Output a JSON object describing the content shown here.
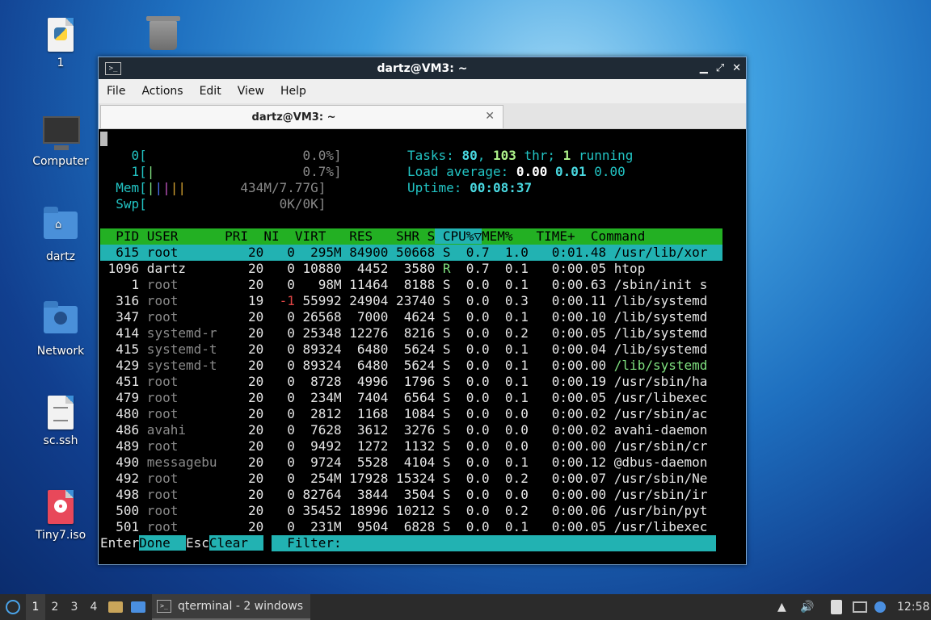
{
  "desktop": {
    "icons": [
      {
        "label": "1",
        "icon": "python-file-icon"
      },
      {
        "label": "",
        "icon": "trash-icon"
      },
      {
        "label": "Computer",
        "icon": "computer-icon"
      },
      {
        "label": "dartz",
        "icon": "home-folder-icon"
      },
      {
        "label": "Network",
        "icon": "network-folder-icon"
      },
      {
        "label": "sc.ssh",
        "icon": "text-file-icon"
      },
      {
        "label": "Tiny7.iso",
        "icon": "disc-image-icon"
      }
    ]
  },
  "window": {
    "title": "dartz@VM3: ~",
    "menu": [
      "File",
      "Actions",
      "Edit",
      "View",
      "Help"
    ],
    "tab_label": "dartz@VM3: ~",
    "close_glyph": "✕"
  },
  "htop": {
    "cpu0": {
      "label": "0[",
      "value": "0.0%]"
    },
    "cpu1": {
      "label": "1[",
      "bars": "|",
      "value": "0.7%]"
    },
    "mem": {
      "label": "Mem[",
      "value": "434M/7.77G]"
    },
    "swp": {
      "label": "Swp[",
      "value": "0K/0K]"
    },
    "tasks": {
      "label": "Tasks: ",
      "count": "80",
      "sep": ", ",
      "threads": "103",
      "thr": " thr; ",
      "running": "1",
      "running_label": " running"
    },
    "load": {
      "label": "Load average: ",
      "l1": "0.00",
      "l5": "0.01",
      "l15": "0.00"
    },
    "uptime": {
      "label": "Uptime: ",
      "value": "00:08:37"
    },
    "columns": {
      "pid": "  PID",
      "user": " USER",
      "pri": "      PRI",
      "ni": "  NI",
      "virt": "  VIRT",
      "res": "   RES",
      "shr": "   SHR",
      "s": " S",
      "cpu": " CPU%▽",
      "mem": "MEM%",
      "time": "   TIME+ ",
      "cmd": " Command"
    },
    "processes": [
      {
        "pid": "615",
        "user": "root",
        "pri": "20",
        "ni": "0",
        "virt": "295M",
        "res": "84900",
        "shr": "50668",
        "s": "S",
        "cpu": "0.7",
        "mem": "1.0",
        "time": "0:01.48",
        "cmd": "/usr/lib/xor"
      },
      {
        "pid": "1096",
        "user": "dartz",
        "pri": "20",
        "ni": "0",
        "virt": "10880",
        "res": "4452",
        "shr": "3580",
        "s": "R",
        "cpu": "0.7",
        "mem": "0.1",
        "time": "0:00.05",
        "cmd": "htop"
      },
      {
        "pid": "1",
        "user": "root",
        "pri": "20",
        "ni": "0",
        "virt": "98M",
        "res": "11464",
        "shr": "8188",
        "s": "S",
        "cpu": "0.0",
        "mem": "0.1",
        "time": "0:00.63",
        "cmd": "/sbin/init s"
      },
      {
        "pid": "316",
        "user": "root",
        "pri": "19",
        "ni": "-1",
        "virt": "55992",
        "res": "24904",
        "shr": "23740",
        "s": "S",
        "cpu": "0.0",
        "mem": "0.3",
        "time": "0:00.11",
        "cmd": "/lib/systemd"
      },
      {
        "pid": "347",
        "user": "root",
        "pri": "20",
        "ni": "0",
        "virt": "26568",
        "res": "7000",
        "shr": "4624",
        "s": "S",
        "cpu": "0.0",
        "mem": "0.1",
        "time": "0:00.10",
        "cmd": "/lib/systemd"
      },
      {
        "pid": "414",
        "user": "systemd-r",
        "pri": "20",
        "ni": "0",
        "virt": "25348",
        "res": "12276",
        "shr": "8216",
        "s": "S",
        "cpu": "0.0",
        "mem": "0.2",
        "time": "0:00.05",
        "cmd": "/lib/systemd"
      },
      {
        "pid": "415",
        "user": "systemd-t",
        "pri": "20",
        "ni": "0",
        "virt": "89324",
        "res": "6480",
        "shr": "5624",
        "s": "S",
        "cpu": "0.0",
        "mem": "0.1",
        "time": "0:00.04",
        "cmd": "/lib/systemd"
      },
      {
        "pid": "429",
        "user": "systemd-t",
        "pri": "20",
        "ni": "0",
        "virt": "89324",
        "res": "6480",
        "shr": "5624",
        "s": "S",
        "cpu": "0.0",
        "mem": "0.1",
        "time": "0:00.00",
        "cmd": "/lib/systemd"
      },
      {
        "pid": "451",
        "user": "root",
        "pri": "20",
        "ni": "0",
        "virt": "8728",
        "res": "4996",
        "shr": "1796",
        "s": "S",
        "cpu": "0.0",
        "mem": "0.1",
        "time": "0:00.19",
        "cmd": "/usr/sbin/ha"
      },
      {
        "pid": "479",
        "user": "root",
        "pri": "20",
        "ni": "0",
        "virt": "234M",
        "res": "7404",
        "shr": "6564",
        "s": "S",
        "cpu": "0.0",
        "mem": "0.1",
        "time": "0:00.05",
        "cmd": "/usr/libexec"
      },
      {
        "pid": "480",
        "user": "root",
        "pri": "20",
        "ni": "0",
        "virt": "2812",
        "res": "1168",
        "shr": "1084",
        "s": "S",
        "cpu": "0.0",
        "mem": "0.0",
        "time": "0:00.02",
        "cmd": "/usr/sbin/ac"
      },
      {
        "pid": "486",
        "user": "avahi",
        "pri": "20",
        "ni": "0",
        "virt": "7628",
        "res": "3612",
        "shr": "3276",
        "s": "S",
        "cpu": "0.0",
        "mem": "0.0",
        "time": "0:00.02",
        "cmd": "avahi-daemon"
      },
      {
        "pid": "489",
        "user": "root",
        "pri": "20",
        "ni": "0",
        "virt": "9492",
        "res": "1272",
        "shr": "1132",
        "s": "S",
        "cpu": "0.0",
        "mem": "0.0",
        "time": "0:00.00",
        "cmd": "/usr/sbin/cr"
      },
      {
        "pid": "490",
        "user": "messagebu",
        "pri": "20",
        "ni": "0",
        "virt": "9724",
        "res": "5528",
        "shr": "4104",
        "s": "S",
        "cpu": "0.0",
        "mem": "0.1",
        "time": "0:00.12",
        "cmd": "@dbus-daemon"
      },
      {
        "pid": "492",
        "user": "root",
        "pri": "20",
        "ni": "0",
        "virt": "254M",
        "res": "17928",
        "shr": "15324",
        "s": "S",
        "cpu": "0.0",
        "mem": "0.2",
        "time": "0:00.07",
        "cmd": "/usr/sbin/Ne"
      },
      {
        "pid": "498",
        "user": "root",
        "pri": "20",
        "ni": "0",
        "virt": "82764",
        "res": "3844",
        "shr": "3504",
        "s": "S",
        "cpu": "0.0",
        "mem": "0.0",
        "time": "0:00.00",
        "cmd": "/usr/sbin/ir"
      },
      {
        "pid": "500",
        "user": "root",
        "pri": "20",
        "ni": "0",
        "virt": "35452",
        "res": "18996",
        "shr": "10212",
        "s": "S",
        "cpu": "0.0",
        "mem": "0.2",
        "time": "0:00.06",
        "cmd": "/usr/bin/pyt"
      },
      {
        "pid": "501",
        "user": "root",
        "pri": "20",
        "ni": "0",
        "virt": "231M",
        "res": "9504",
        "shr": "6828",
        "s": "S",
        "cpu": "0.0",
        "mem": "0.1",
        "time": "0:00.05",
        "cmd": "/usr/libexec"
      }
    ],
    "footer": {
      "enter_key": "Enter",
      "enter_label": "Done  ",
      "esc_key": "Esc",
      "esc_label": "Clear  ",
      "filter_label": "  Filter: "
    }
  },
  "taskbar": {
    "workspaces": [
      "1",
      "2",
      "3",
      "4"
    ],
    "active_workspace": "1",
    "task_label": "qterminal - 2 windows",
    "clock": "12:58"
  },
  "colors": {
    "selection": "#22b2b2",
    "header": "#23b023",
    "window_border": "#7aa7d6"
  }
}
